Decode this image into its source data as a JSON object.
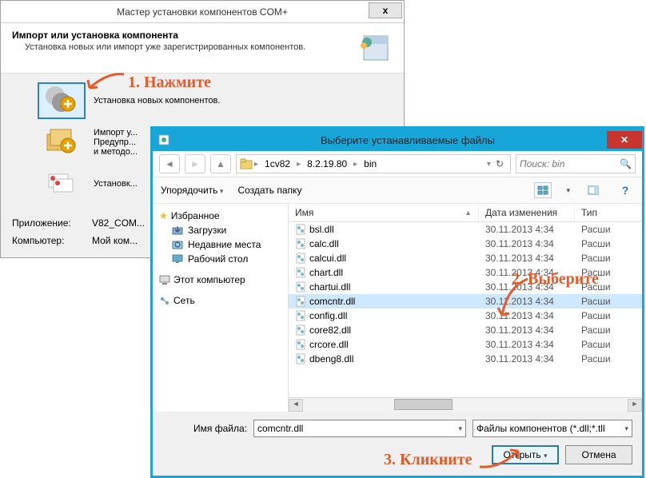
{
  "wizard": {
    "title": "Мастер установки компонентов COM+",
    "header_title": "Импорт или установка компонента",
    "header_sub": "Установка новых или импорт уже зарегистрированных компонентов.",
    "opt1": "Установка новых компонентов.",
    "opt2": "Импорт у...\nПредупр...\nи методо...",
    "opt3": "Установк...",
    "footer_app_label": "Приложение:",
    "footer_app_value": "V82_COM...",
    "footer_comp_label": "Компьютер:",
    "footer_comp_value": "Мой ком..."
  },
  "filedlg": {
    "title": "Выберите устанавливаемые файлы",
    "breadcrumb": [
      "1cv82",
      "8.2.19.80",
      "bin"
    ],
    "search_placeholder": "Поиск: bin",
    "toolbar": {
      "organize": "Упорядочить",
      "newfolder": "Создать папку"
    },
    "sidebar": {
      "favorites": "Избранное",
      "fav_items": [
        "Загрузки",
        "Недавние места",
        "Рабочий стол"
      ],
      "thispc": "Этот компьютер",
      "network": "Сеть"
    },
    "columns": {
      "name": "Имя",
      "date": "Дата изменения",
      "type": "Тип"
    },
    "files": [
      {
        "name": "bsl.dll",
        "date": "30.11.2013 4:34",
        "type": "Расши"
      },
      {
        "name": "calc.dll",
        "date": "30.11.2013 4:34",
        "type": "Расши"
      },
      {
        "name": "calcui.dll",
        "date": "30.11.2013 4:34",
        "type": "Расши"
      },
      {
        "name": "chart.dll",
        "date": "30.11.2013 4:34",
        "type": "Расши"
      },
      {
        "name": "chartui.dll",
        "date": "30.11.2013 4:34",
        "type": "Расши"
      },
      {
        "name": "comcntr.dll",
        "date": "30.11.2013 4:34",
        "type": "Расши"
      },
      {
        "name": "config.dll",
        "date": "30.11.2013 4:34",
        "type": "Расши"
      },
      {
        "name": "core82.dll",
        "date": "30.11.2013 4:34",
        "type": "Расши"
      },
      {
        "name": "crcore.dll",
        "date": "30.11.2013 4:34",
        "type": "Расши"
      },
      {
        "name": "dbeng8.dll",
        "date": "30.11.2013 4:34",
        "type": "Расши"
      }
    ],
    "selected_index": 5,
    "footer": {
      "fname_label": "Имя файла:",
      "fname_value": "comcntr.dll",
      "filter": "Файлы компонентов (*.dll;*.tll",
      "open": "Открыть",
      "cancel": "Отмена"
    }
  },
  "annotations": {
    "step1": "1. Нажмите",
    "step2": "2. Выберите",
    "step3": "3. Кликните"
  }
}
